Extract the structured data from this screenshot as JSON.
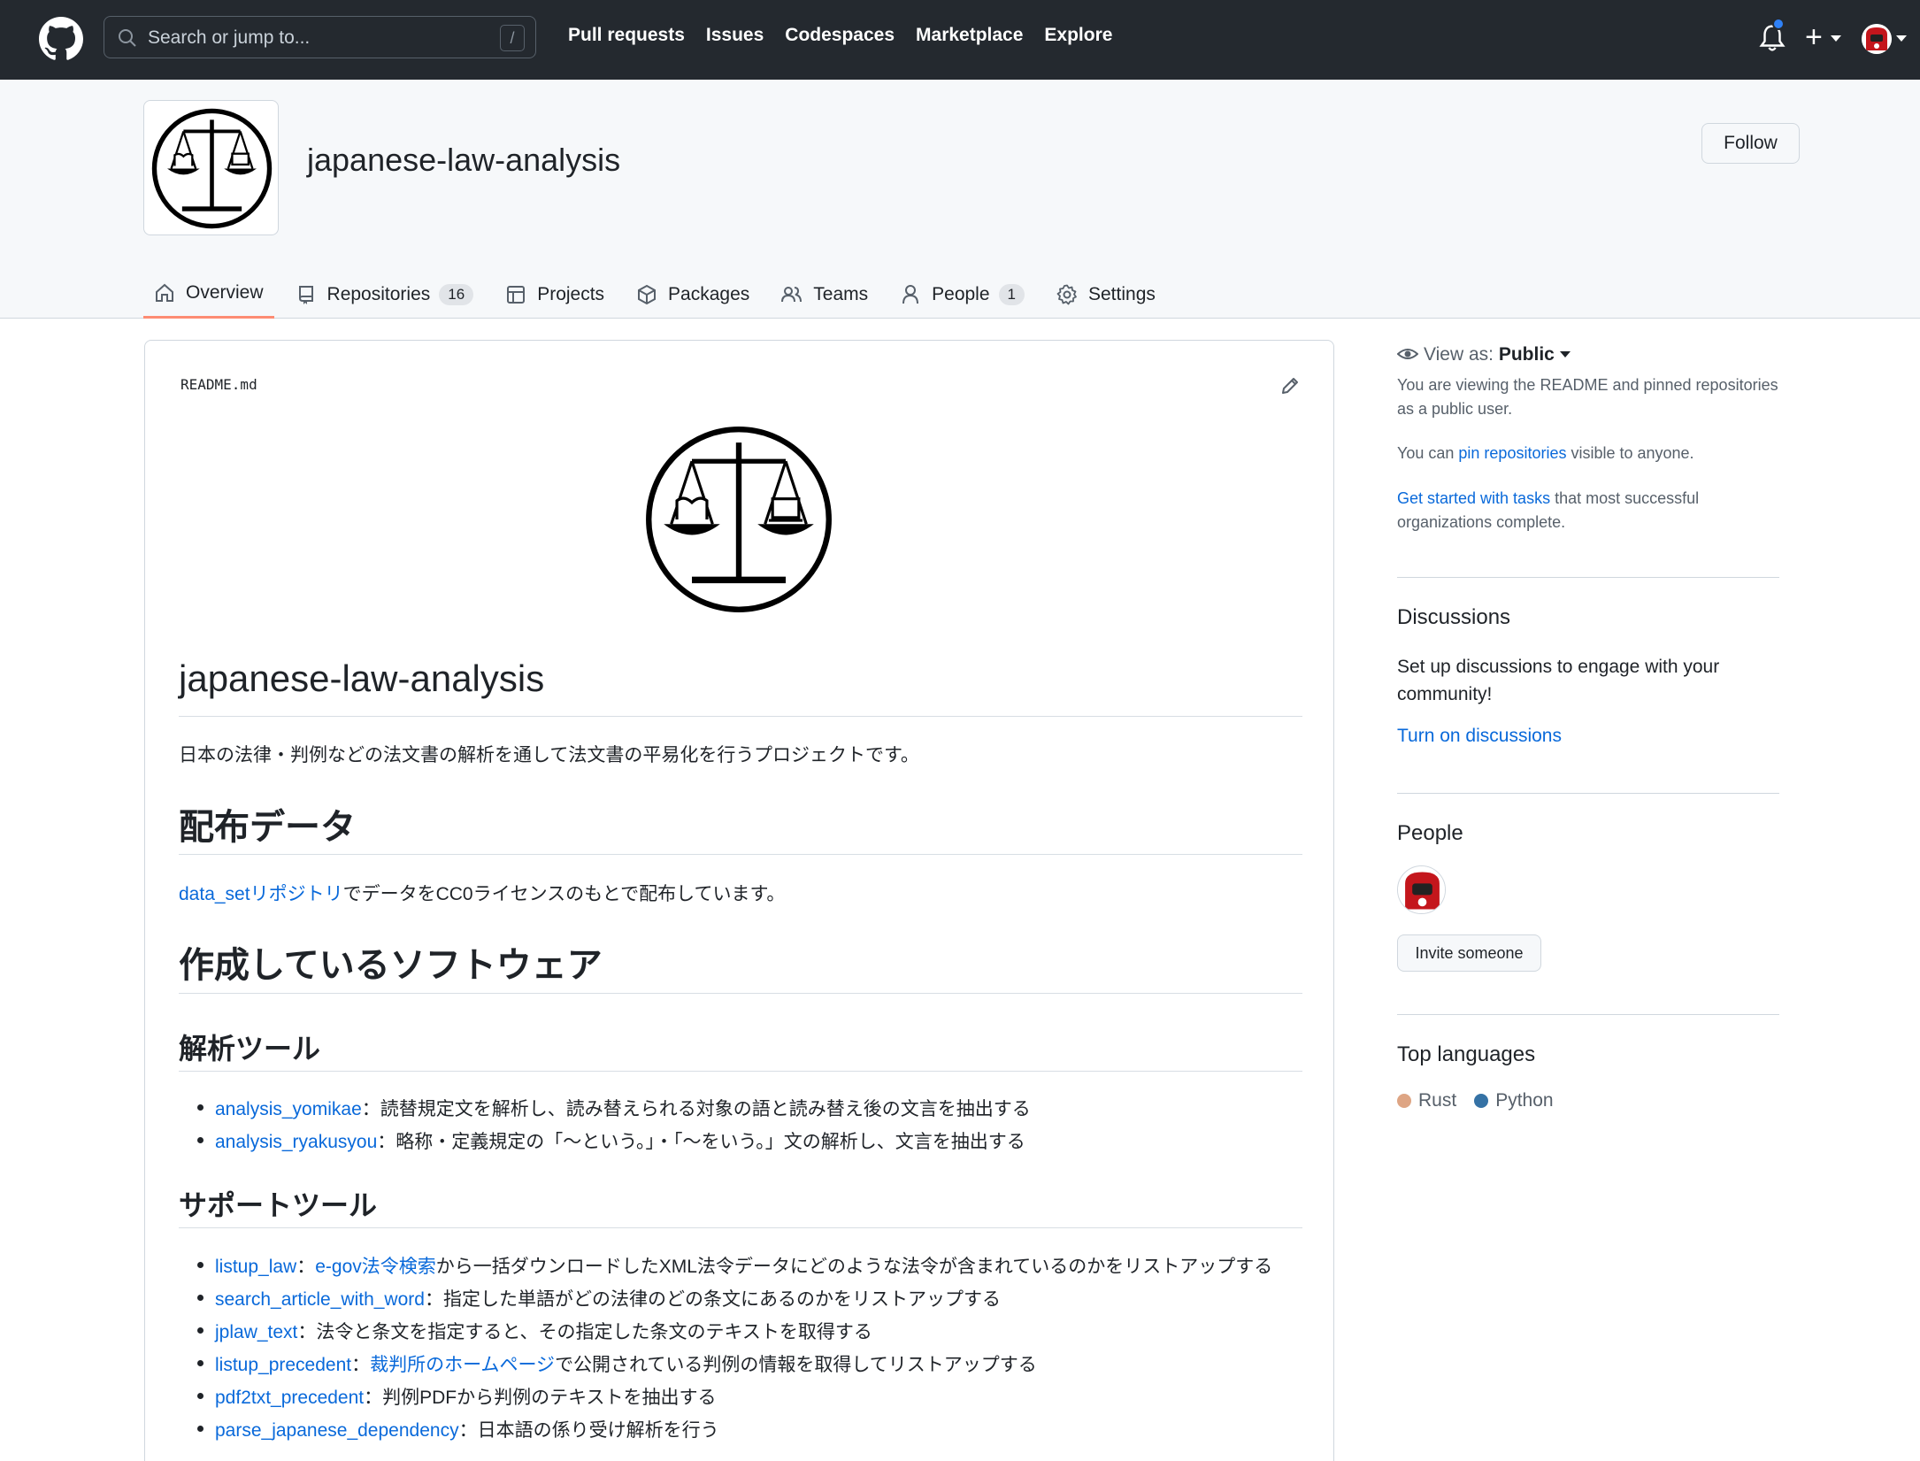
{
  "topnav": {
    "search_placeholder": "Search or jump to...",
    "search_shortcut": "/",
    "links": [
      "Pull requests",
      "Issues",
      "Codespaces",
      "Marketplace",
      "Explore"
    ],
    "plus_label": "+"
  },
  "org": {
    "name": "japanese-law-analysis",
    "follow_label": "Follow"
  },
  "tabs": [
    {
      "label": "Overview",
      "icon": "home-icon",
      "active": true
    },
    {
      "label": "Repositories",
      "icon": "repo-icon",
      "count": "16"
    },
    {
      "label": "Projects",
      "icon": "table-icon"
    },
    {
      "label": "Packages",
      "icon": "package-icon"
    },
    {
      "label": "Teams",
      "icon": "people-icon"
    },
    {
      "label": "People",
      "icon": "person-icon",
      "count": "1"
    },
    {
      "label": "Settings",
      "icon": "gear-icon"
    }
  ],
  "readme": {
    "filename": "README.md",
    "title": "japanese-law-analysis",
    "intro": "日本の法律・判例などの法文書の解析を通して法文書の平易化を行うプロジェクトです。",
    "h_data": "配布データ",
    "data_link": "data_setリポジトリ",
    "data_text": "でデータをCC0ライセンスのもとで配布しています。",
    "h_software": "作成しているソフトウェア",
    "h_analysis": "解析ツール",
    "analysis_items": [
      {
        "link": "analysis_yomikae",
        "text": "：読替規定文を解析し、読み替えられる対象の語と読み替え後の文言を抽出する"
      },
      {
        "link": "analysis_ryakusyou",
        "text": "：略称・定義規定の「～という。」・「～をいう。」文の解析し、文言を抽出する"
      }
    ],
    "h_support": "サポートツール",
    "support_items": [
      {
        "link": "listup_law",
        "sep": "：",
        "link2": "e-gov法令検索",
        "text": "から一括ダウンロードしたXML法令データにどのような法令が含まれているのかをリストアップする"
      },
      {
        "link": "search_article_with_word",
        "sep": "",
        "link2": "",
        "text": "：指定した単語がどの法律のどの条文にあるのかをリストアップする"
      },
      {
        "link": "jplaw_text",
        "sep": "",
        "link2": "",
        "text": "：法令と条文を指定すると、その指定した条文のテキストを取得する"
      },
      {
        "link": "listup_precedent",
        "sep": "：",
        "link2": "裁判所のホームページ",
        "text": "で公開されている判例の情報を取得してリストアップする"
      },
      {
        "link": "pdf2txt_precedent",
        "sep": "",
        "link2": "",
        "text": "：判例PDFから判例のテキストを抽出する"
      },
      {
        "link": "parse_japanese_dependency",
        "sep": "",
        "link2": "",
        "text": "：日本語の係り受け解析を行う"
      }
    ]
  },
  "sidebar": {
    "view_as_label": "View as:",
    "view_as_value": "Public",
    "viewing_note": "You are viewing the README and pinned repositories as a public user.",
    "pin_prefix": "You can ",
    "pin_link": "pin repositories",
    "pin_suffix": " visible to anyone.",
    "tasks_link": "Get started with tasks",
    "tasks_suffix": " that most successful organizations complete.",
    "discussions_heading": "Discussions",
    "discussions_text": "Set up discussions to engage with your community!",
    "discussions_link": "Turn on discussions",
    "people_heading": "People",
    "invite_label": "Invite someone",
    "languages_heading": "Top languages",
    "languages": [
      {
        "name": "Rust",
        "color": "#dea584"
      },
      {
        "name": "Python",
        "color": "#3572A5"
      }
    ]
  },
  "colors": {
    "topbar": "#24292f",
    "link": "#0969da",
    "active_tab_underline": "#fd8c73",
    "notification_dot": "#2f81f7"
  }
}
